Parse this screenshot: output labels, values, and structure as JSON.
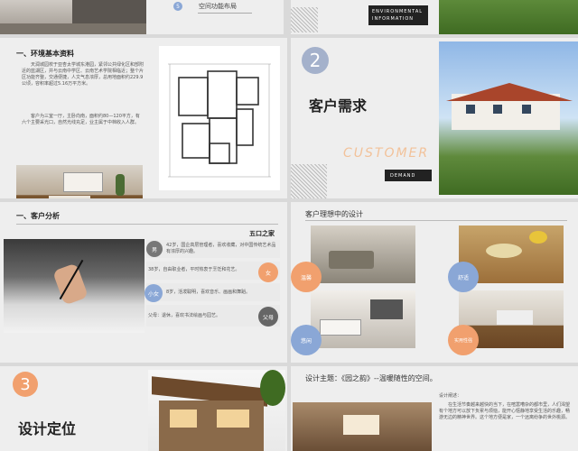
{
  "slide_top_mid": {
    "step_num": "5",
    "label": "空间功能布局"
  },
  "slide_top_right": {
    "badge_line1": "ENVIRONMENTAL",
    "badge_line2": "INFORMATION"
  },
  "slide_env": {
    "title": "一、环境基本资料",
    "para1": "天润城园校于亚杏太学城东港园，紧邻公共绿化区和部附近的蓝湖区，并与云南中学区、云南艺术学院相临近；整个片区功能齐整，交通便捷，人文气息浓厚，总用地面积约229.9公顷，容积率超过5.16万平方米。",
    "para2": "客户为三室一厅，主卧向南，面积约80—120平方，有六个主要采光口，自然光线充足，业主属于中档收入人群。"
  },
  "slide_demand": {
    "num": "2",
    "title": "客户需求",
    "watermark": "CUSTOMER",
    "badge": "DEMAND"
  },
  "slide_analysis": {
    "title": "一、客户分析",
    "family_label": "五口之家",
    "rows": [
      {
        "icon": "男",
        "text": "42岁，国企高层管理者，喜欢收藏，对中国传统艺术品有浓厚的兴趣。"
      },
      {
        "icon": "女",
        "text": "38岁，自由职业者，平时热衷于烹饪和花艺。"
      },
      {
        "icon": "小女",
        "text": "8岁，活泼聪明，喜欢音乐、画画和舞蹈。"
      },
      {
        "icon": "父母",
        "text": "父母：退休，喜欢书法绘画与园艺。"
      }
    ]
  },
  "slide_ideal": {
    "title": "客户理想中的设计",
    "bubbles": [
      "温馨",
      "舒适",
      "悠闲",
      "实用性强"
    ]
  },
  "slide_position": {
    "num": "3",
    "title": "设计定位"
  },
  "slide_theme": {
    "title": "设计主题：《园之韵》--温暖随性的空间。",
    "desc_label": "设计阐述：",
    "desc": "在生活节奏越来越快的当下，在喧嚣嘈杂的都市里，人们渴望有个地方可以放下负累与烦恼，能开心惬静地享受生活的乐趣，畅游无边的精神世界。这个地方便是家，一个远离纷争的世外桃源。"
  }
}
